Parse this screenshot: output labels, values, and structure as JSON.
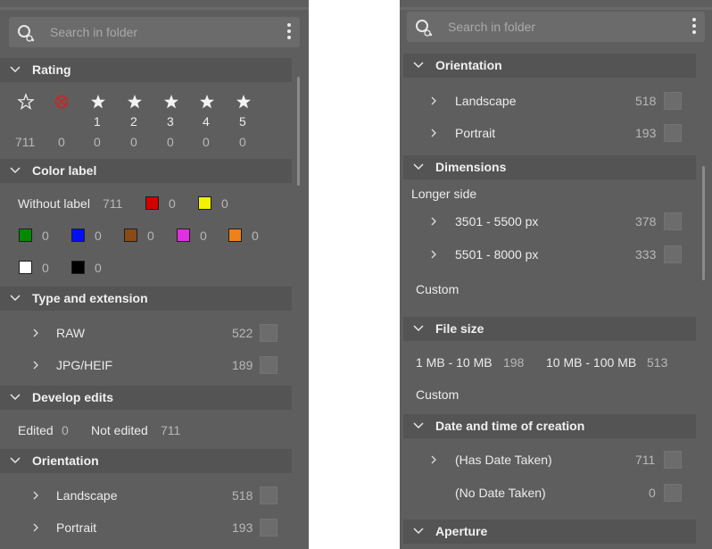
{
  "search": {
    "placeholder": "Search in folder"
  },
  "left": {
    "rating": {
      "title": "Rating",
      "items": [
        {
          "label": "",
          "count": "711",
          "icon": "star-outline-icon"
        },
        {
          "label": "",
          "count": "0",
          "icon": "rejected-icon"
        },
        {
          "label": "1",
          "count": "0",
          "icon": "star-icon"
        },
        {
          "label": "2",
          "count": "0",
          "icon": "star-icon"
        },
        {
          "label": "3",
          "count": "0",
          "icon": "star-icon"
        },
        {
          "label": "4",
          "count": "0",
          "icon": "star-icon"
        },
        {
          "label": "5",
          "count": "0",
          "icon": "star-icon"
        }
      ]
    },
    "color_label": {
      "title": "Color label",
      "without_label": "Without label",
      "without_count": "711",
      "colors": [
        {
          "name": "red",
          "hex": "#d40000",
          "count": "0"
        },
        {
          "name": "yellow",
          "hex": "#f2f200",
          "count": "0"
        },
        {
          "name": "green",
          "hex": "#008a00",
          "count": "0"
        },
        {
          "name": "blue",
          "hex": "#0010f0",
          "count": "0"
        },
        {
          "name": "brown",
          "hex": "#8a4a14",
          "count": "0"
        },
        {
          "name": "magenta",
          "hex": "#e030e0",
          "count": "0"
        },
        {
          "name": "orange",
          "hex": "#f08018",
          "count": "0"
        },
        {
          "name": "white",
          "hex": "#ffffff",
          "count": "0"
        },
        {
          "name": "black",
          "hex": "#000000",
          "count": "0"
        }
      ]
    },
    "type_ext": {
      "title": "Type and extension",
      "items": [
        {
          "label": "RAW",
          "count": "522"
        },
        {
          "label": "JPG/HEIF",
          "count": "189"
        }
      ]
    },
    "develop": {
      "title": "Develop edits",
      "edited": "Edited",
      "edited_count": "0",
      "not_edited": "Not edited",
      "not_edited_count": "711"
    },
    "orientation": {
      "title": "Orientation",
      "items": [
        {
          "label": "Landscape",
          "count": "518"
        },
        {
          "label": "Portrait",
          "count": "193"
        }
      ]
    }
  },
  "right": {
    "orientation": {
      "title": "Orientation",
      "items": [
        {
          "label": "Landscape",
          "count": "518"
        },
        {
          "label": "Portrait",
          "count": "193"
        }
      ]
    },
    "dimensions": {
      "title": "Dimensions",
      "subtitle": "Longer side",
      "items": [
        {
          "label": "3501 - 5500 px",
          "count": "378"
        },
        {
          "label": "5501 - 8000 px",
          "count": "333"
        }
      ],
      "custom": "Custom"
    },
    "file_size": {
      "title": "File size",
      "items": [
        {
          "label": "1 MB - 10 MB",
          "count": "198"
        },
        {
          "label": "10 MB - 100 MB",
          "count": "513"
        }
      ],
      "custom": "Custom"
    },
    "date": {
      "title": "Date and time of creation",
      "items": [
        {
          "label": "(Has Date Taken)",
          "count": "711"
        },
        {
          "label": "(No Date Taken)",
          "count": "0"
        }
      ]
    },
    "aperture": {
      "title": "Aperture"
    }
  }
}
